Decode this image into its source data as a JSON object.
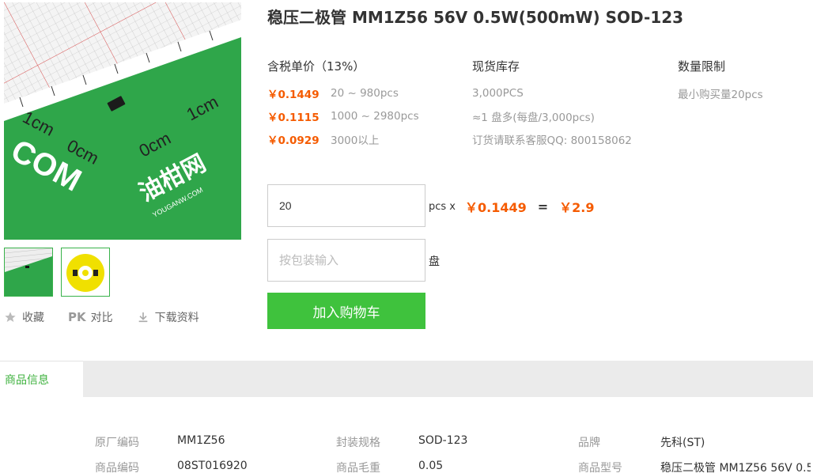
{
  "product": {
    "title": "稳压二极管 MM1Z56 56V 0.5W(500mW) SOD-123"
  },
  "images": {
    "main_labels": [
      "1cm",
      "0cm",
      "1cm",
      "0cm",
      "COM",
      "YOUGANW.COM",
      "油柑网"
    ],
    "thumb_count": 2
  },
  "actions": {
    "favorite": "收藏",
    "compare_badge": "PK",
    "compare": "对比",
    "download": "下载资料"
  },
  "pricing": {
    "header": "含税单价（13%）",
    "tiers": [
      {
        "price": "￥0.1449",
        "range": "20 ~ 980pcs"
      },
      {
        "price": "￥0.1115",
        "range": "1000 ~ 2980pcs"
      },
      {
        "price": "￥0.0929",
        "range": "3000以上"
      }
    ]
  },
  "stock": {
    "header": "现货库存",
    "lines": [
      "3,000PCS",
      "≈1 盘多(每盘/3,000pcs)",
      "订货请联系客服QQ: 800158062"
    ]
  },
  "limit": {
    "header": "数量限制",
    "lines": [
      "最小购买量20pcs"
    ]
  },
  "order": {
    "qty_value": "20",
    "unit": "pcs x",
    "unit_price": "￥0.1449",
    "equals": "=",
    "total": "￥2.9",
    "reel_placeholder": "按包装输入",
    "reel_unit": "盘",
    "add_to_cart": "加入购物车"
  },
  "tabs": {
    "product_info": "商品信息"
  },
  "specs": [
    {
      "key": "原厂编码",
      "value": "MM1Z56"
    },
    {
      "key": "封装规格",
      "value": "SOD-123"
    },
    {
      "key": "品牌",
      "value": "先科(ST)"
    },
    {
      "key": "商品编码",
      "value": "08ST016920"
    },
    {
      "key": "商品毛重",
      "value": "0.05"
    },
    {
      "key": "商品型号",
      "value": "稳压二极管 MM1Z56 56V 0.5..."
    }
  ],
  "colors": {
    "accent_green": "#3fc23d",
    "price_orange": "#f55b00"
  }
}
